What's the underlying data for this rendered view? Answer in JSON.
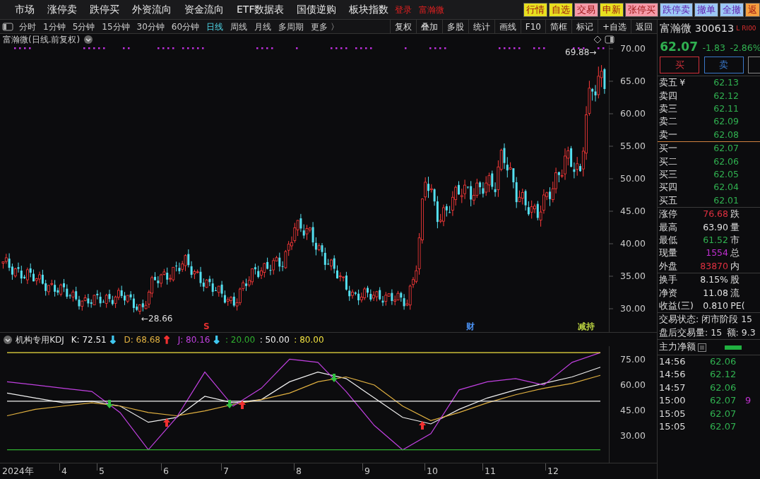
{
  "menu": {
    "items": [
      "市场",
      "涨停卖",
      "跌停买",
      "外资流向",
      "资金流向",
      "ETF数据表",
      "国债逆购",
      "板块指数"
    ],
    "alerts": [
      "登录",
      "富瀚微"
    ],
    "buttons": [
      {
        "label": "行情",
        "color": "#e8e020"
      },
      {
        "label": "自选",
        "color": "#e8e020"
      },
      {
        "label": "交易",
        "color": "#f59aa8"
      },
      {
        "label": "申新",
        "color": "#e8e020"
      },
      {
        "label": "张停买",
        "color": "#f59aa8"
      },
      {
        "label": "跌停卖",
        "color": "#9cc8f5"
      },
      {
        "label": "撤单",
        "color": "#9cc8f5"
      },
      {
        "label": "全撤",
        "color": "#9cc8f5"
      },
      {
        "label": "返",
        "color": "#f5a040"
      }
    ]
  },
  "toolbar": {
    "periods": [
      {
        "label": "分时",
        "selected": false
      },
      {
        "label": "1分钟",
        "selected": false
      },
      {
        "label": "5分钟",
        "selected": false
      },
      {
        "label": "15分钟",
        "selected": false
      },
      {
        "label": "30分钟",
        "selected": false
      },
      {
        "label": "60分钟",
        "selected": false
      },
      {
        "label": "日线",
        "selected": true
      },
      {
        "label": "周线",
        "selected": false
      },
      {
        "label": "月线",
        "selected": false
      },
      {
        "label": "多周期",
        "selected": false
      },
      {
        "label": "更多 〉",
        "selected": false
      }
    ],
    "tools": [
      "复权",
      "叠加",
      "多股",
      "统计",
      "画线",
      "F10",
      "简框",
      "标记",
      "+自选",
      "返回"
    ]
  },
  "chart": {
    "title": "富瀚微(日线.前复权)",
    "price_axis": [
      "70.00",
      "65.00",
      "60.00",
      "55.00",
      "50.00",
      "45.00",
      "40.00",
      "35.00",
      "30.00"
    ],
    "high_label": "69.88→",
    "low_label": "←28.66",
    "markers": [
      {
        "text": "S",
        "color": "#e83030"
      },
      {
        "text": "财",
        "color": "#4a90f0"
      },
      {
        "text": "减持",
        "color": "#b8d040"
      }
    ]
  },
  "kdj": {
    "name": "机构专用KDJ",
    "readings": [
      {
        "text": "K: 72.51",
        "color": "#f0f0f0",
        "arrow": {
          "glyph": "↓",
          "color": "#40c8f0"
        }
      },
      {
        "text": "D: 68.68",
        "color": "#e0b040",
        "arrow": {
          "glyph": "↑",
          "color": "#f03030"
        }
      },
      {
        "text": "J: 80.16",
        "color": "#c040e0",
        "arrow": {
          "glyph": "↓",
          "color": "#40c8f0"
        }
      }
    ],
    "date_axis": [
      "2024年",
      "4",
      "5",
      "6",
      "7",
      "8",
      "9",
      "10",
      "11",
      "12"
    ],
    "levels": [
      {
        "text": ": 20.00",
        "color": "#30b030"
      },
      {
        "text": ": 50.00",
        "color": "#f0f0f0"
      },
      {
        "text": ": 80.00",
        "color": "#f0e040"
      }
    ],
    "chart_data": {
      "type": "line",
      "categories": [
        null,
        null,
        null,
        null,
        null,
        null,
        null,
        null,
        null,
        null,
        null,
        null,
        null,
        null,
        null,
        null,
        null,
        null,
        null,
        null,
        null,
        null
      ],
      "series": [
        {
          "color": "#f0f0f0",
          "values": [
            55,
            52,
            49,
            50,
            47,
            37,
            40,
            53,
            49,
            51,
            62,
            68,
            64,
            52,
            40,
            36,
            45,
            52,
            57,
            61,
            65,
            71
          ]
        },
        {
          "color": "#e0b040",
          "values": [
            41,
            45,
            47,
            49,
            47,
            43,
            41,
            44,
            48,
            51,
            55,
            62,
            65,
            60,
            47,
            38,
            43,
            49,
            54,
            58,
            61,
            66
          ]
        },
        {
          "color": "#c040e0",
          "values": [
            62,
            60,
            58,
            56,
            43,
            20,
            40,
            68,
            47,
            58,
            76,
            74,
            56,
            35,
            20,
            30,
            57,
            62,
            64,
            60,
            74,
            80
          ]
        },
        {
          "color": "#f0e040",
          "values": [
            80,
            80,
            80,
            80,
            80,
            80,
            80,
            80,
            80,
            80,
            80,
            80,
            80,
            80,
            80,
            80,
            80,
            80,
            80,
            80,
            80,
            80
          ]
        },
        {
          "color": "#f0f0f0",
          "values": [
            50,
            50,
            50,
            50,
            50,
            50,
            50,
            50,
            50,
            50,
            50,
            50,
            50,
            50,
            50,
            50,
            50,
            50,
            50,
            50,
            50,
            50
          ]
        },
        {
          "color": "#30b030",
          "values": [
            20,
            20,
            20,
            20,
            20,
            20,
            20,
            20,
            20,
            20,
            20,
            20,
            20,
            20,
            20,
            20,
            20,
            20,
            20,
            20,
            20,
            20
          ]
        }
      ],
      "ylim": [
        12,
        84
      ],
      "yticks": [
        {
          "value": 75,
          "label": "75.00"
        },
        {
          "value": 60,
          "label": "60.00"
        },
        {
          "value": 45,
          "label": "45.00"
        },
        {
          "value": 30,
          "label": "30.00"
        }
      ]
    }
  },
  "quote": {
    "name": "富瀚微",
    "code": "300613",
    "flags": [
      "L",
      "RI00"
    ],
    "price": "62.07",
    "change": "-1.83",
    "change_pct": "-2.86%"
  },
  "trade_buttons": [
    {
      "label": "买",
      "color": "#d0303a"
    },
    {
      "label": "卖",
      "color": "#3a78c8"
    },
    {
      "color": "#888888"
    }
  ],
  "order_book": {
    "asks": [
      {
        "label": "卖五",
        "currency": "¥",
        "price": "62.13"
      },
      {
        "label": "卖四",
        "price": "62.12"
      },
      {
        "label": "卖三",
        "price": "62.11"
      },
      {
        "label": "卖二",
        "price": "62.09"
      },
      {
        "label": "卖一",
        "price": "62.08"
      }
    ],
    "bids": [
      {
        "label": "买一",
        "price": "62.07"
      },
      {
        "label": "买二",
        "price": "62.06"
      },
      {
        "label": "买三",
        "price": "62.05"
      },
      {
        "label": "买四",
        "price": "62.04"
      },
      {
        "label": "买五",
        "price": "62.01"
      }
    ]
  },
  "stats": [
    [
      {
        "label": "涨停",
        "value": "76.68",
        "color": "#e03040",
        "extra": "跌"
      },
      {
        "label": "最高",
        "value": "63.90",
        "color": "#e0e0e0",
        "extra": "量"
      },
      {
        "label": "最低",
        "value": "61.52",
        "color": "#30b050",
        "extra": "市"
      },
      {
        "label": "现量",
        "value": "1554",
        "color": "#c030d0",
        "extra": "总"
      },
      {
        "label": "外盘",
        "value": "83870",
        "color": "#e03040",
        "extra": "内"
      }
    ],
    [
      {
        "label": "换手",
        "value": "8.15%",
        "color": "#e0e0e0",
        "extra": "股"
      },
      {
        "label": "净资",
        "value": "11.08",
        "color": "#e0e0e0",
        "extra": "流"
      },
      {
        "label": "收益(三)",
        "value": "0.810",
        "color": "#e0e0e0",
        "extra": "PE("
      }
    ]
  ],
  "status": [
    [
      "交易状态: 闭市阶段 15"
    ],
    [
      "盘后交易量: 15",
      "额: 9.3"
    ]
  ],
  "main_flow": {
    "label": "主力净额"
  },
  "ticks": [
    {
      "time": "14:56",
      "price": "62.06"
    },
    {
      "time": "14:56",
      "price": "62.12"
    },
    {
      "time": "14:57",
      "price": "62.06"
    },
    {
      "time": "15:00",
      "price": "62.07",
      "volume": "9"
    },
    {
      "time": "15:05",
      "price": "62.07"
    },
    {
      "time": "15:05",
      "price": "62.07"
    }
  ]
}
